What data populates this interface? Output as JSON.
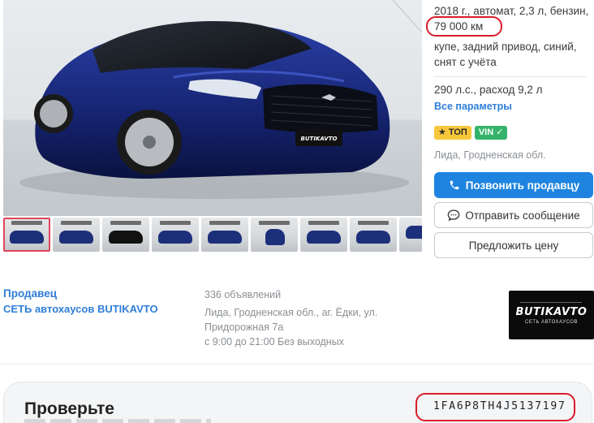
{
  "listing": {
    "specs_line1": "2018 г., автомат, 2,3 л, бензин,",
    "mileage": "79 000 км",
    "specs_line2": "купе, задний привод, синий,",
    "specs_line3": "снят с учёта",
    "specs_line4": "290 л.с., расход 9,2 л",
    "all_params_link": "Все параметры",
    "badge_top": "ТОП",
    "badge_vin": "VIN ✓",
    "location": "Лида, Гродненская обл."
  },
  "photo": {
    "plate_text": "BUTIKAVTO",
    "thumbnail_count": 9
  },
  "actions": {
    "call_label": "Позвонить продавцу",
    "message_label": "Отправить сообщение",
    "offer_label": "Предложить цену"
  },
  "seller": {
    "label": "Продавец",
    "name": "СЕТЬ автохаусов BUTIKAVTO",
    "ads_count": "336 объявлений",
    "address_line1": "Лида, Гродненская обл., аг. Ёдки, ул.",
    "address_line2": "Придорожная 7а",
    "hours": "с 9:00 до 21:00 Без выходных",
    "logo_brand": "BUTIKAVTO",
    "logo_sub": "СЕТЬ АВТОХАУСОВ"
  },
  "check": {
    "title": "Проверьте",
    "vin": "1FA6P8TH4J5137197"
  },
  "colors": {
    "accent": "#1e84e0",
    "link": "#2f7ed8",
    "highlight_ring": "#d91c2a",
    "badge_top": "#f7c73b",
    "badge_vin": "#34b36a"
  }
}
